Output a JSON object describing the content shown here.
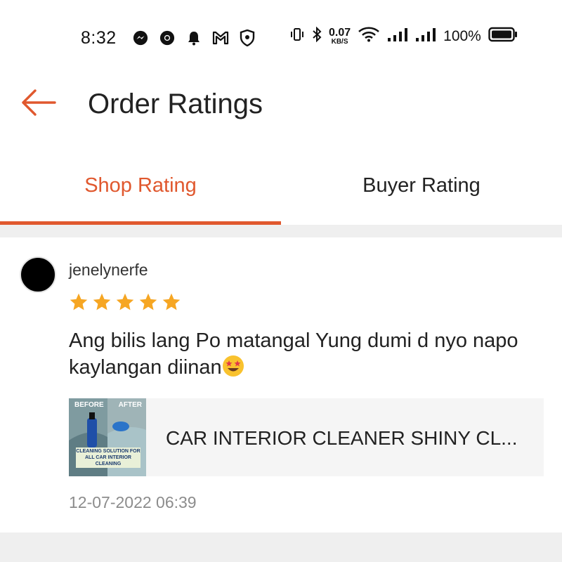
{
  "status_bar": {
    "time": "8:32",
    "left_icons": [
      "messenger-icon",
      "chrome-icon",
      "bell-icon",
      "gmail-icon",
      "shield-icon"
    ],
    "net_speed_value": "0.07",
    "net_speed_unit": "KB/S",
    "battery_percent": "100%"
  },
  "header": {
    "back_icon": "back-arrow-icon",
    "title": "Order Ratings"
  },
  "tabs": [
    {
      "label": "Shop Rating",
      "active": true
    },
    {
      "label": "Buyer Rating",
      "active": false
    }
  ],
  "review": {
    "username": "jenelynerfe",
    "rating": 5,
    "rating_max": 5,
    "comment": "Ang bilis lang Po matangal Yung dumi d nyo napo kaylangan diinan",
    "comment_emoji": "star-struck-emoji",
    "product": {
      "name": "CAR INTERIOR CLEANER SHINY CL...",
      "thumbnail_before": "BEFORE",
      "thumbnail_after": "AFTER",
      "thumbnail_caption": "CLEANING SOLUTION FOR ALL CAR INTERIOR CLEANING"
    },
    "date": "12-07-2022 06:39"
  },
  "colors": {
    "accent": "#e0582e",
    "star": "#f6a623",
    "divider_bg": "#efefef",
    "muted_text": "#8c8c8c"
  }
}
